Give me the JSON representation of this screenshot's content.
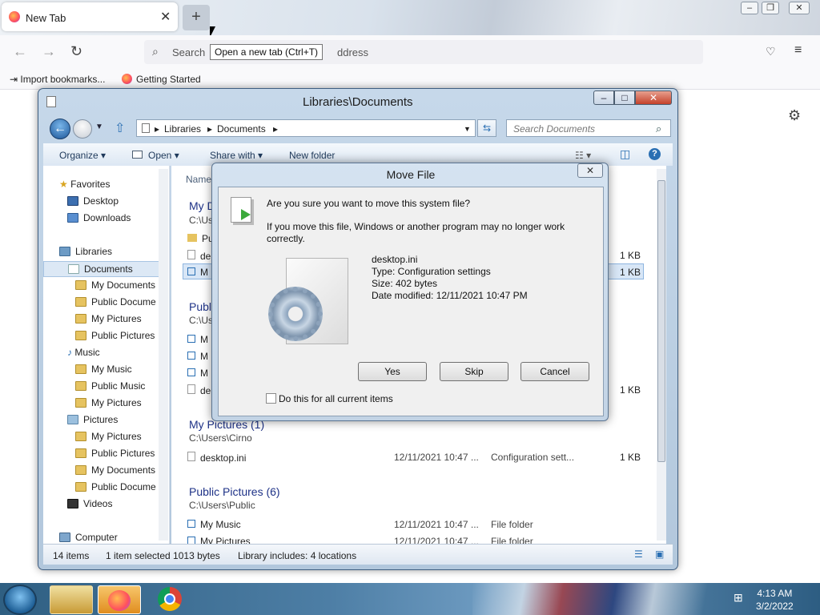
{
  "browser": {
    "tab_title": "New Tab",
    "tab_close": "✕",
    "new_tab_symbol": "+",
    "tooltip": "Open a new tab (Ctrl+T)",
    "search_placeholder": "Search",
    "search_placeholder_tail": "ddress",
    "bookmarks": [
      "Import bookmarks...",
      "Getting Started"
    ]
  },
  "explorer": {
    "title": "Libraries\\Documents",
    "breadcrumb": [
      "Libraries",
      "Documents"
    ],
    "search_placeholder": "Search Documents",
    "toolbar": {
      "organize": "Organize ▾",
      "open": "Open ▾",
      "share": "Share with ▾",
      "new_folder": "New folder"
    },
    "column_name": "Name",
    "nav": {
      "favorites": "Favorites",
      "desktop": "Desktop",
      "downloads": "Downloads",
      "libraries": "Libraries",
      "documents": "Documents",
      "doc_items": [
        "My Documents",
        "Public Docume",
        "My Pictures",
        "Public Pictures"
      ],
      "music": "Music",
      "music_items": [
        "My Music",
        "Public Music",
        "My Pictures"
      ],
      "pictures": "Pictures",
      "pic_items": [
        "My Pictures",
        "Public Pictures",
        "My Documents",
        "Public Docume"
      ],
      "videos": "Videos",
      "computer": "Computer"
    },
    "content": {
      "group1": "My D",
      "group1_path": "C:\\Us",
      "g1_rows": [
        "Pu",
        "de",
        "M"
      ],
      "g1_sizes": [
        "1 KB",
        "1 KB"
      ],
      "group2": "Publ",
      "group2_path": "C:\\Us",
      "g2_rows": [
        "M",
        "M",
        "M",
        "de"
      ],
      "g2_size": "1 KB",
      "group3": "My Pictures (1)",
      "group3_path": "C:\\Users\\Cirno",
      "g3_row": {
        "name": "desktop.ini",
        "date": "12/11/2021 10:47 ...",
        "type": "Configuration sett...",
        "size": "1 KB"
      },
      "group4": "Public Pictures (6)",
      "group4_path": "C:\\Users\\Public",
      "g4_rows": [
        {
          "name": "My Music",
          "date": "12/11/2021 10:47 ...",
          "type": "File folder"
        },
        {
          "name": "My Pictures",
          "date": "12/11/2021 10:47 ...",
          "type": "File folder"
        }
      ]
    },
    "status": {
      "count": "14 items",
      "selected": "1 item selected  1013 bytes",
      "library": "Library includes: 4 locations"
    }
  },
  "dialog": {
    "title": "Move File",
    "question": "Are you sure you want to move this system file?",
    "warning_line1": "If you move this file, Windows or another program may no longer work",
    "warning_line2": "correctly.",
    "file_name": "desktop.ini",
    "file_type": "Type: Configuration settings",
    "file_size": "Size: 402 bytes",
    "file_modified": "Date modified: 12/11/2021 10:47 PM",
    "btn_yes": "Yes",
    "btn_skip": "Skip",
    "btn_cancel": "Cancel",
    "checkbox_label": "Do this for all current items"
  },
  "taskbar": {
    "time": "4:13 AM",
    "date": "3/2/2022"
  }
}
